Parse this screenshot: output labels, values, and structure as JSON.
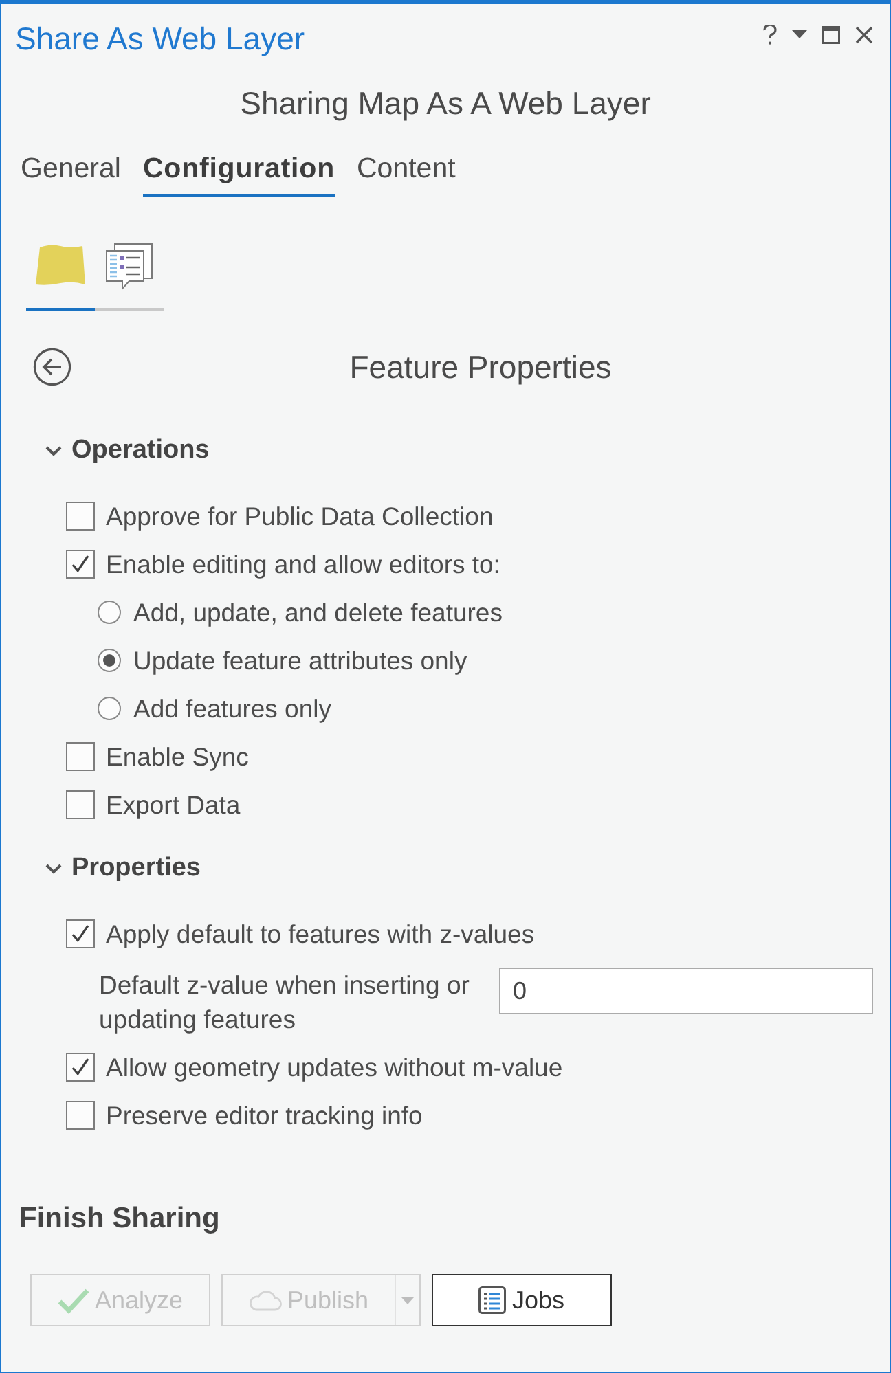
{
  "window": {
    "title": "Share As Web Layer"
  },
  "header": {
    "title": "Sharing Map As A Web Layer"
  },
  "tabs": [
    {
      "label": "General",
      "selected": false
    },
    {
      "label": "Configuration",
      "selected": true
    },
    {
      "label": "Content",
      "selected": false
    }
  ],
  "subtabs": [
    {
      "kind": "layer",
      "selected": true
    },
    {
      "kind": "properties",
      "selected": false
    }
  ],
  "pane": {
    "title": "Feature Properties"
  },
  "sections": [
    {
      "title": "Operations",
      "expanded": true,
      "items": [
        {
          "kind": "checkbox",
          "label": "Approve for Public Data Collection",
          "checked": false
        },
        {
          "kind": "checkbox",
          "label": "Enable editing and allow editors to:",
          "checked": true,
          "children": [
            {
              "kind": "radio",
              "label": "Add, update, and delete features",
              "selected": false
            },
            {
              "kind": "radio",
              "label": "Update feature attributes only",
              "selected": true
            },
            {
              "kind": "radio",
              "label": "Add features only",
              "selected": false
            }
          ]
        },
        {
          "kind": "checkbox",
          "label": "Enable Sync",
          "checked": false
        },
        {
          "kind": "checkbox",
          "label": "Export Data",
          "checked": false
        }
      ]
    },
    {
      "title": "Properties",
      "expanded": true,
      "items": [
        {
          "kind": "checkbox",
          "label": "Apply default to features with z-values",
          "checked": true
        },
        {
          "kind": "field",
          "label": "Default z-value when inserting or updating features",
          "value": "0"
        },
        {
          "kind": "checkbox",
          "label": "Allow geometry updates without m-value",
          "checked": true
        },
        {
          "kind": "checkbox",
          "label": "Preserve editor tracking info",
          "checked": false
        }
      ]
    }
  ],
  "finish": {
    "title": "Finish Sharing",
    "buttons": [
      {
        "kind": "analyze",
        "label": "Analyze",
        "disabled": true,
        "dropdown": false
      },
      {
        "kind": "publish",
        "label": "Publish",
        "disabled": true,
        "dropdown": true
      },
      {
        "kind": "jobs",
        "label": "Jobs",
        "disabled": false,
        "dropdown": false
      }
    ]
  }
}
